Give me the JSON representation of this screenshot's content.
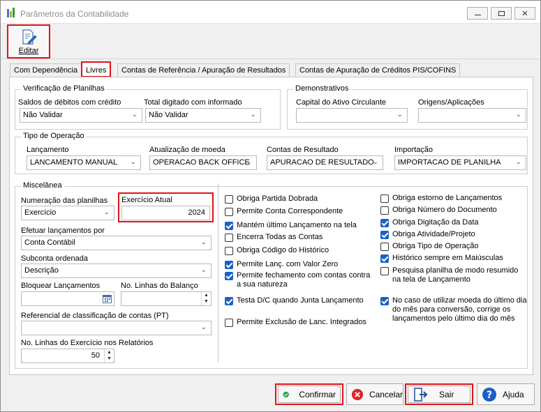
{
  "window": {
    "title": "Parâmetros da Contabilidade",
    "buttons": {
      "minimize": "—",
      "restore": "❐",
      "close": "✕"
    }
  },
  "toolbar": {
    "editar_label": "Editar"
  },
  "tabs": [
    {
      "label": "Com Dependência"
    },
    {
      "label": "Livres"
    },
    {
      "label": "Contas de Referência / Apuração de Resultados"
    },
    {
      "label": "Contas de Apuração de Créditos PIS/COFINS"
    }
  ],
  "verificacao": {
    "title": "Verificação de Planilhas",
    "saldos_label": "Saldos de débitos com crédito",
    "saldos_value": "Não Validar",
    "total_label": "Total digitado com informado",
    "total_value": "Não Validar"
  },
  "demonstrativos": {
    "title": "Demonstrativos",
    "capital_label": "Capital do Ativo Circulante",
    "capital_value": "",
    "origens_label": "Origens/Aplicações",
    "origens_value": ""
  },
  "tipo_operacao": {
    "title": "Tipo de Operação",
    "lancamento_label": "Lançamento",
    "lancamento_value": "LANCAMENTO MANUAL",
    "atualizacao_label": "Atualização de moeda",
    "atualizacao_value": "OPERACAO BACK OFFICE",
    "contas_label": "Contas de Resultado",
    "contas_value": "APURACAO DE RESULTADO",
    "importacao_label": "Importação",
    "importacao_value": "IMPORTACAO DE PLANILHA"
  },
  "miscelanea": {
    "title": "Miscelânea",
    "numeracao_label": "Numeração das planilhas",
    "numeracao_value": "Exercício",
    "exercicio_label": "Exercício Atual",
    "exercicio_value": "2024",
    "efetuar_label": "Efetuar lançamentos por",
    "efetuar_value": "Conta Contábil",
    "subconta_label": "Subconta ordenada",
    "subconta_value": "Descrição",
    "bloquear_label": "Bloquear Lançamentos",
    "bloquear_value": "",
    "linhas_balanco_label": "No. Linhas do Balanço",
    "linhas_balanco_value": "",
    "referencial_label": "Referencial de classificação de contas (PT)",
    "referencial_value": "",
    "linhas_exercicio_label": "No. Linhas do Exercício nos Relatórios",
    "linhas_exercicio_value": "50"
  },
  "checks_left": [
    {
      "label": "Obriga Partida Dobrada",
      "checked": false
    },
    {
      "label": "Permite Conta Correspondente",
      "checked": false
    },
    {
      "label": "Mantém último Lançamento na tela",
      "checked": true
    },
    {
      "label": "Encerra Todas as Contas",
      "checked": false
    },
    {
      "label": "Obriga Código do Histórico",
      "checked": false
    },
    {
      "label": "Permite Lanç. com Valor Zero",
      "checked": true
    },
    {
      "label": "Permite fechamento com contas contra a sua natureza",
      "checked": true
    },
    {
      "label": "Testa D/C quando Junta Lançamento",
      "checked": true
    },
    {
      "label": "Permite Exclusão de Lanc. Integrados",
      "checked": false
    }
  ],
  "checks_right": [
    {
      "label": "Obriga estorno de Lançamentos",
      "checked": false
    },
    {
      "label": "Obriga Número do Documento",
      "checked": false
    },
    {
      "label": "Obriga Digitação da Data",
      "checked": true
    },
    {
      "label": "Obriga Atividade/Projeto",
      "checked": true
    },
    {
      "label": "Obriga Tipo de Operação",
      "checked": false
    },
    {
      "label": "Histórico sempre em Maiúsculas",
      "checked": true
    },
    {
      "label": "Pesquisa planilha de modo resumido na tela de Lançamento",
      "checked": false
    },
    {
      "label": "No caso de utilizar moeda do último dia do mês para conversão, corrige os lançamentos pelo último dia do mês",
      "checked": true
    }
  ],
  "buttons": {
    "confirmar": "Confirmar",
    "cancelar": "Cancelar",
    "sair": "Sair",
    "ajuda": "Ajuda"
  },
  "colors": {
    "accent": "#e0131a",
    "check": "#1a62c4"
  }
}
